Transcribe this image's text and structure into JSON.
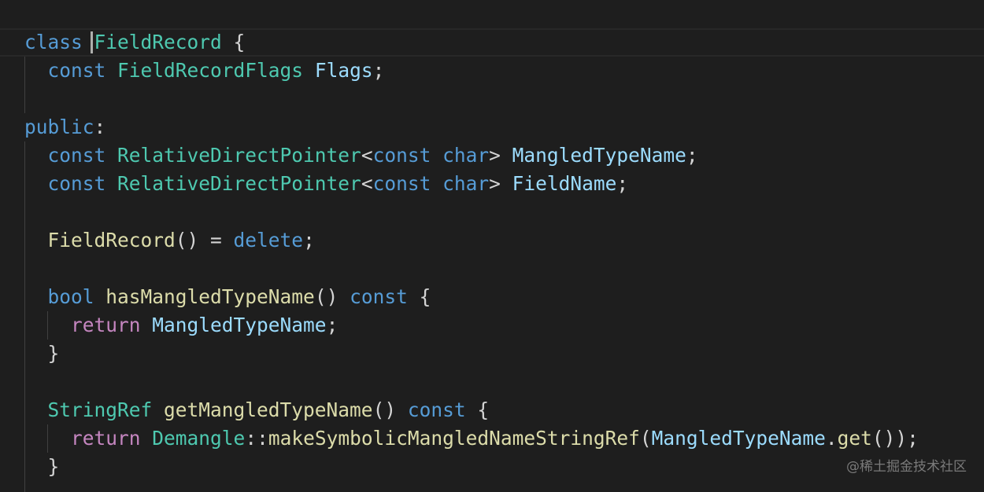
{
  "code_lines": [
    [
      [
        "kw",
        "class"
      ],
      [
        "pun",
        " "
      ],
      [
        "ty",
        "FieldRecord"
      ],
      [
        "pun",
        " {"
      ]
    ],
    [
      [
        "pun",
        "  "
      ],
      [
        "kw",
        "const"
      ],
      [
        "pun",
        " "
      ],
      [
        "ty",
        "FieldRecordFlags"
      ],
      [
        "pun",
        " "
      ],
      [
        "var",
        "Flags"
      ],
      [
        "pun",
        ";"
      ]
    ],
    [],
    [
      [
        "kw",
        "public"
      ],
      [
        "pun",
        ":"
      ]
    ],
    [
      [
        "pun",
        "  "
      ],
      [
        "kw",
        "const"
      ],
      [
        "pun",
        " "
      ],
      [
        "ty",
        "RelativeDirectPointer"
      ],
      [
        "pun",
        "<"
      ],
      [
        "kw",
        "const"
      ],
      [
        "pun",
        " "
      ],
      [
        "kw",
        "char"
      ],
      [
        "pun",
        "> "
      ],
      [
        "var",
        "MangledTypeName"
      ],
      [
        "pun",
        ";"
      ]
    ],
    [
      [
        "pun",
        "  "
      ],
      [
        "kw",
        "const"
      ],
      [
        "pun",
        " "
      ],
      [
        "ty",
        "RelativeDirectPointer"
      ],
      [
        "pun",
        "<"
      ],
      [
        "kw",
        "const"
      ],
      [
        "pun",
        " "
      ],
      [
        "kw",
        "char"
      ],
      [
        "pun",
        "> "
      ],
      [
        "var",
        "FieldName"
      ],
      [
        "pun",
        ";"
      ]
    ],
    [],
    [
      [
        "pun",
        "  "
      ],
      [
        "fn",
        "FieldRecord"
      ],
      [
        "pun",
        "() = "
      ],
      [
        "kw",
        "delete"
      ],
      [
        "pun",
        ";"
      ]
    ],
    [],
    [
      [
        "pun",
        "  "
      ],
      [
        "kw",
        "bool"
      ],
      [
        "pun",
        " "
      ],
      [
        "fn",
        "hasMangledTypeName"
      ],
      [
        "pun",
        "() "
      ],
      [
        "kw",
        "const"
      ],
      [
        "pun",
        " {"
      ]
    ],
    [
      [
        "pun",
        "    "
      ],
      [
        "ctl",
        "return"
      ],
      [
        "pun",
        " "
      ],
      [
        "var",
        "MangledTypeName"
      ],
      [
        "pun",
        ";"
      ]
    ],
    [
      [
        "pun",
        "  }"
      ]
    ],
    [],
    [
      [
        "pun",
        "  "
      ],
      [
        "ty",
        "StringRef"
      ],
      [
        "pun",
        " "
      ],
      [
        "fn",
        "getMangledTypeName"
      ],
      [
        "pun",
        "() "
      ],
      [
        "kw",
        "const"
      ],
      [
        "pun",
        " {"
      ]
    ],
    [
      [
        "pun",
        "    "
      ],
      [
        "ctl",
        "return"
      ],
      [
        "pun",
        " "
      ],
      [
        "ty",
        "Demangle"
      ],
      [
        "pun",
        "::"
      ],
      [
        "fn",
        "makeSymbolicMangledNameStringRef"
      ],
      [
        "pun",
        "("
      ],
      [
        "var",
        "MangledTypeName"
      ],
      [
        "pun",
        "."
      ],
      [
        "fn",
        "get"
      ],
      [
        "pun",
        "());"
      ]
    ],
    [
      [
        "pun",
        "  }"
      ]
    ]
  ],
  "token_colors": {
    "keyword": "#569cd6",
    "type": "#4ec9b0",
    "function": "#dcdcaa",
    "variable": "#9cdcfe",
    "control": "#c586c0",
    "punctuation": "#d4d4d4",
    "background": "#1e1e1e"
  },
  "watermark": "@稀土掘金技术社区"
}
